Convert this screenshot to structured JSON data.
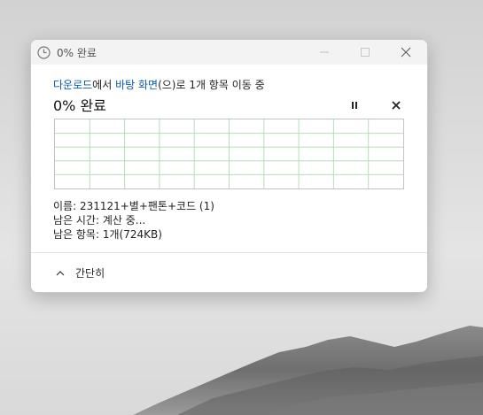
{
  "window": {
    "title": "0% 완료",
    "icon": "clock-icon"
  },
  "description": {
    "source": "다운로드",
    "part1": "에서 ",
    "dest": "바탕 화면",
    "part2": "(으)로 1개 항목 이동 중"
  },
  "progress": {
    "percent_label": "0% 완료",
    "value": 0
  },
  "details": {
    "name_line": "이름: 231121+별+팬톤+코드 (1)",
    "time_line": "남은 시간: 계산 중...",
    "items_line": "남은 항목: 1개(724KB)"
  },
  "footer": {
    "fewer_details_label": "간단히"
  },
  "colors": {
    "link": "#0b5cad",
    "graph_grid": "#9fd39f"
  }
}
